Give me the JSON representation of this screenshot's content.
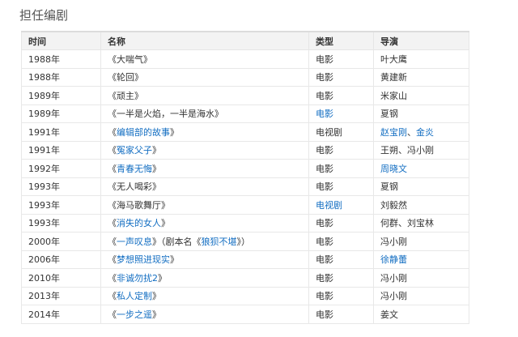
{
  "section": {
    "title": "担任编剧"
  },
  "table": {
    "headers": [
      "时间",
      "名称",
      "类型",
      "导演"
    ],
    "rows": [
      {
        "year": "1988年",
        "title": [
          {
            "t": "《大喘气》"
          }
        ],
        "type": {
          "t": "电影"
        },
        "director": [
          {
            "t": "叶大鹰"
          }
        ]
      },
      {
        "year": "1988年",
        "title": [
          {
            "t": "《轮回》"
          }
        ],
        "type": {
          "t": "电影"
        },
        "director": [
          {
            "t": "黄建新"
          }
        ]
      },
      {
        "year": "1989年",
        "title": [
          {
            "t": "《顽主》"
          }
        ],
        "type": {
          "t": "电影"
        },
        "director": [
          {
            "t": "米家山"
          }
        ]
      },
      {
        "year": "1989年",
        "title": [
          {
            "t": "《一半是火焰，一半是海水》"
          }
        ],
        "type": {
          "t": "电影",
          "link": true
        },
        "director": [
          {
            "t": "夏钢"
          }
        ]
      },
      {
        "year": "1991年",
        "title": [
          {
            "t": "《"
          },
          {
            "t": "编辑部的故事",
            "link": true
          },
          {
            "t": "》"
          }
        ],
        "type": {
          "t": "电视剧"
        },
        "director": [
          {
            "t": "赵宝刚",
            "link": true
          },
          {
            "t": "、"
          },
          {
            "t": "金炎",
            "link": true
          }
        ]
      },
      {
        "year": "1991年",
        "title": [
          {
            "t": "《"
          },
          {
            "t": "冤家父子",
            "link": true
          },
          {
            "t": "》"
          }
        ],
        "type": {
          "t": "电影"
        },
        "director": [
          {
            "t": "王朔、冯小刚"
          }
        ]
      },
      {
        "year": "1992年",
        "title": [
          {
            "t": "《"
          },
          {
            "t": "青春无悔",
            "link": true
          },
          {
            "t": "》"
          }
        ],
        "type": {
          "t": "电影"
        },
        "director": [
          {
            "t": "周晓文",
            "link": true
          }
        ]
      },
      {
        "year": "1993年",
        "title": [
          {
            "t": "《无人喝彩》"
          }
        ],
        "type": {
          "t": "电影"
        },
        "director": [
          {
            "t": "夏钢"
          }
        ]
      },
      {
        "year": "1993年",
        "title": [
          {
            "t": "《海马歌舞厅》"
          }
        ],
        "type": {
          "t": "电视剧",
          "link": true
        },
        "director": [
          {
            "t": "刘毅然"
          }
        ]
      },
      {
        "year": "1993年",
        "title": [
          {
            "t": "《"
          },
          {
            "t": "消失的女人",
            "link": true
          },
          {
            "t": "》"
          }
        ],
        "type": {
          "t": "电影"
        },
        "director": [
          {
            "t": "何群、刘宝林"
          }
        ]
      },
      {
        "year": "2000年",
        "title": [
          {
            "t": "《"
          },
          {
            "t": "一声叹息",
            "link": true
          },
          {
            "t": "》（剧本名《"
          },
          {
            "t": "狼狈不堪",
            "link": true
          },
          {
            "t": "》）"
          }
        ],
        "type": {
          "t": "电影"
        },
        "director": [
          {
            "t": "冯小刚"
          }
        ]
      },
      {
        "year": "2006年",
        "title": [
          {
            "t": "《"
          },
          {
            "t": "梦想照进现实",
            "link": true
          },
          {
            "t": "》"
          }
        ],
        "type": {
          "t": "电影"
        },
        "director": [
          {
            "t": "徐静蕾",
            "link": true
          }
        ]
      },
      {
        "year": "2010年",
        "title": [
          {
            "t": "《"
          },
          {
            "t": "非诚勿扰2",
            "link": true
          },
          {
            "t": "》"
          }
        ],
        "type": {
          "t": "电影"
        },
        "director": [
          {
            "t": "冯小刚"
          }
        ]
      },
      {
        "year": "2013年",
        "title": [
          {
            "t": "《"
          },
          {
            "t": "私人定制",
            "link": true
          },
          {
            "t": "》"
          }
        ],
        "type": {
          "t": "电影"
        },
        "director": [
          {
            "t": "冯小刚"
          }
        ]
      },
      {
        "year": "2014年",
        "title": [
          {
            "t": "《"
          },
          {
            "t": "一步之遥",
            "link": true
          },
          {
            "t": "》"
          }
        ],
        "type": {
          "t": "电影"
        },
        "director": [
          {
            "t": "姜文"
          }
        ]
      }
    ]
  },
  "colors": {
    "link": "#136ec2",
    "text": "#333333",
    "header_bg": "#f3f3f3",
    "border": "#e8e8e8"
  }
}
